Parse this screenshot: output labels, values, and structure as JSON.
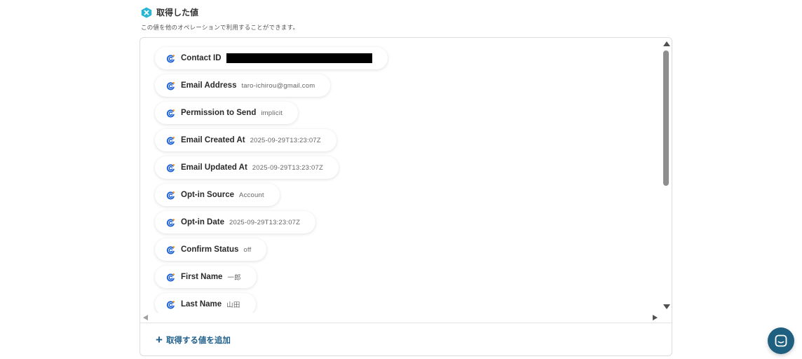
{
  "section": {
    "title": "取得した値",
    "description": "この値を他のオペレーションで利用することができます。"
  },
  "values": [
    {
      "key": "Contact ID",
      "value": "",
      "redacted": true
    },
    {
      "key": "Email Address",
      "value": "taro-ichirou@gmail.com"
    },
    {
      "key": "Permission to Send",
      "value": "implicit"
    },
    {
      "key": "Email Created At",
      "value": "2025-09-29T13:23:07Z"
    },
    {
      "key": "Email Updated At",
      "value": "2025-09-29T13:23:07Z"
    },
    {
      "key": "Opt-in Source",
      "value": "Account"
    },
    {
      "key": "Opt-in Date",
      "value": "2025-09-29T13:23:07Z"
    },
    {
      "key": "Confirm Status",
      "value": "off"
    },
    {
      "key": "First Name",
      "value": "一郎"
    },
    {
      "key": "Last Name",
      "value": "山田"
    }
  ],
  "add_button": {
    "label": "取得する値を追加"
  },
  "icons": {
    "section": "hexagon-x-icon",
    "value_chip": "constant-contact-icon",
    "add": "plus-icon",
    "chat": "chat-icon"
  },
  "colors": {
    "accent": "#1f5f8b",
    "hex_icon": "#29b6d6",
    "chat_bubble": "#1f5f7f",
    "chip_icon_blue": "#1a5fd6",
    "chip_icon_orange": "#f59a23"
  }
}
